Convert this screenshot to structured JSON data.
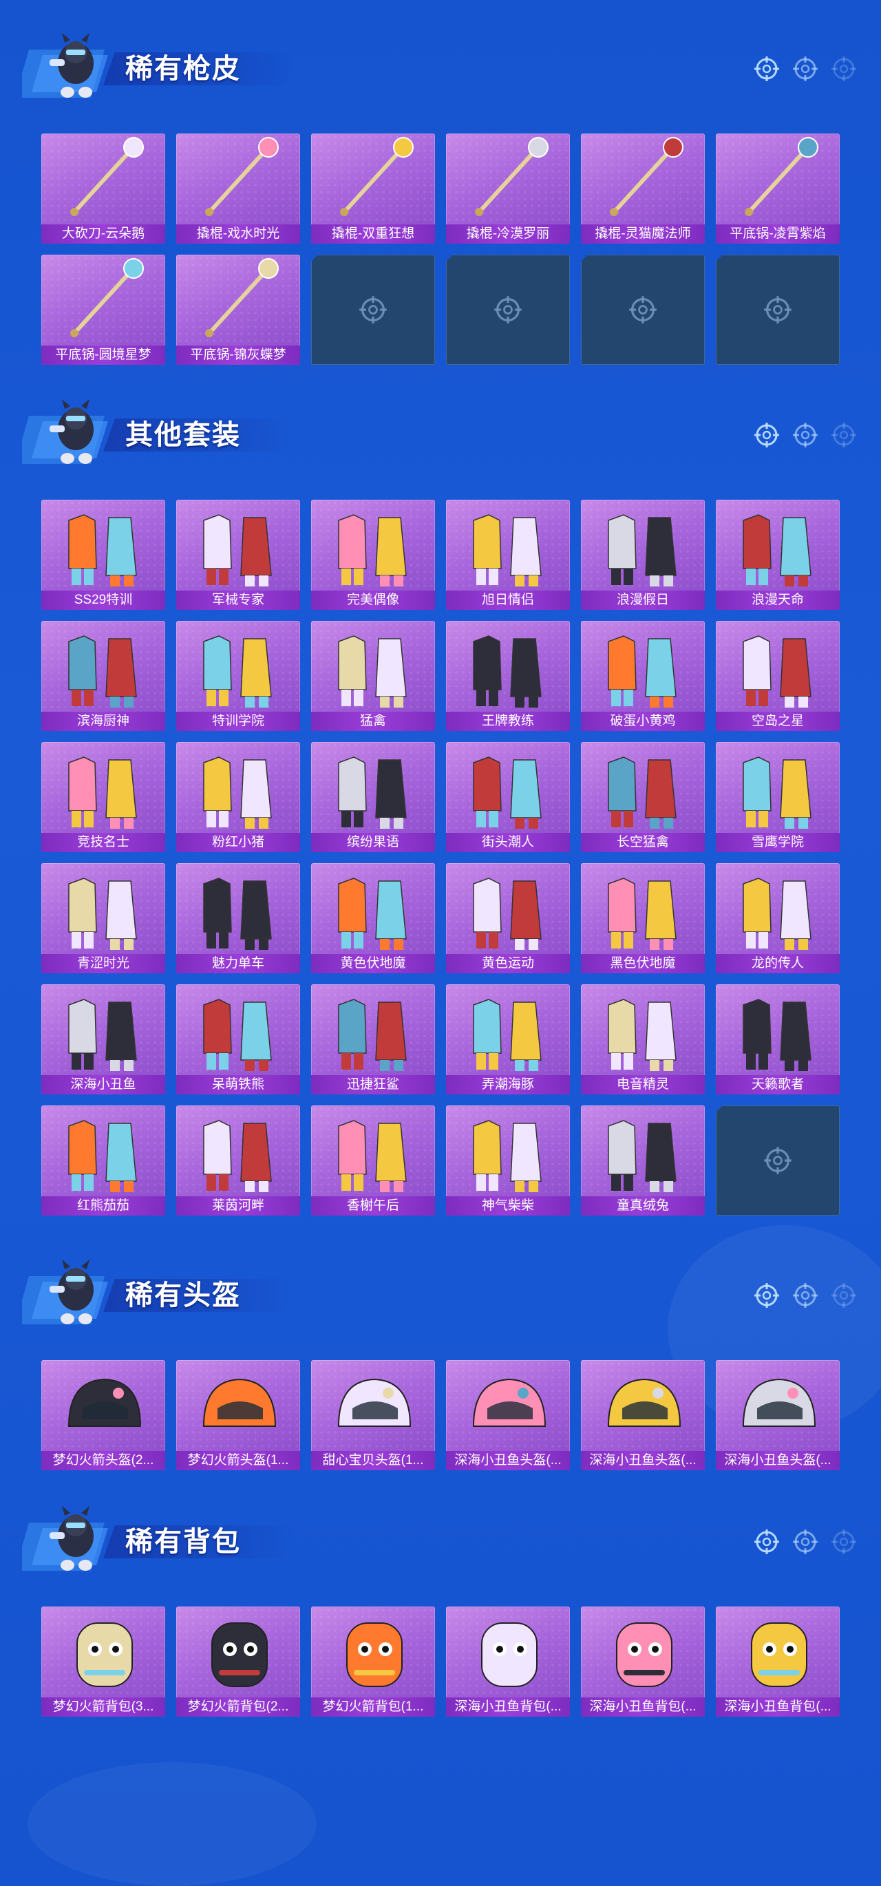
{
  "colors": {
    "background": "#1553cf",
    "tile_purple": "#a766dc",
    "label_purple": "#8a35c8",
    "empty_tile": "#23466e"
  },
  "sections": [
    {
      "title": "稀有枪皮",
      "items": [
        "大砍刀-云朵鹅",
        "撬棍-戏水时光",
        "撬棍-双重狂想",
        "撬棍-冷漠罗丽",
        "撬棍-灵猫魔法师",
        "平底锅-凌霄紫焰",
        "平底锅-圆境星梦",
        "平底锅-锦灰蝶梦"
      ],
      "empty_slots": 4,
      "item_icons": [
        "weapon-icon"
      ]
    },
    {
      "title": "其他套装",
      "items": [
        "SS29特训",
        "军械专家",
        "完美偶像",
        "旭日情侣",
        "浪漫假日",
        "浪漫天命",
        "滨海厨神",
        "特训学院",
        "猛禽",
        "王牌教练",
        "破蛋小黄鸡",
        "空岛之星",
        "竞技名士",
        "粉红小猪",
        "缤纷果语",
        "街头潮人",
        "长空猛禽",
        "雪鹰学院",
        "青涩时光",
        "魅力单车",
        "黄色伏地魔",
        "黄色运动",
        "黑色伏地魔",
        "龙的传人",
        "深海小丑鱼",
        "呆萌铁熊",
        "迅捷狂鲨",
        "弄潮海豚",
        "电音精灵",
        "天籁歌者",
        "红熊茄茄",
        "莱茵河畔",
        "香榭午后",
        "神气柴柴",
        "童真绒兔"
      ],
      "empty_slots": 1
    },
    {
      "title": "稀有头盔",
      "items": [
        "梦幻火箭头盔(2...",
        "梦幻火箭头盔(1...",
        "甜心宝贝头盔(1...",
        "深海小丑鱼头盔(...",
        "深海小丑鱼头盔(...",
        "深海小丑鱼头盔(..."
      ],
      "empty_slots": 0
    },
    {
      "title": "稀有背包",
      "items": [
        "梦幻火箭背包(3...",
        "梦幻火箭背包(2...",
        "梦幻火箭背包(1...",
        "深海小丑鱼背包(...",
        "深海小丑鱼背包(...",
        "深海小丑鱼背包(..."
      ],
      "empty_slots": 0
    }
  ]
}
